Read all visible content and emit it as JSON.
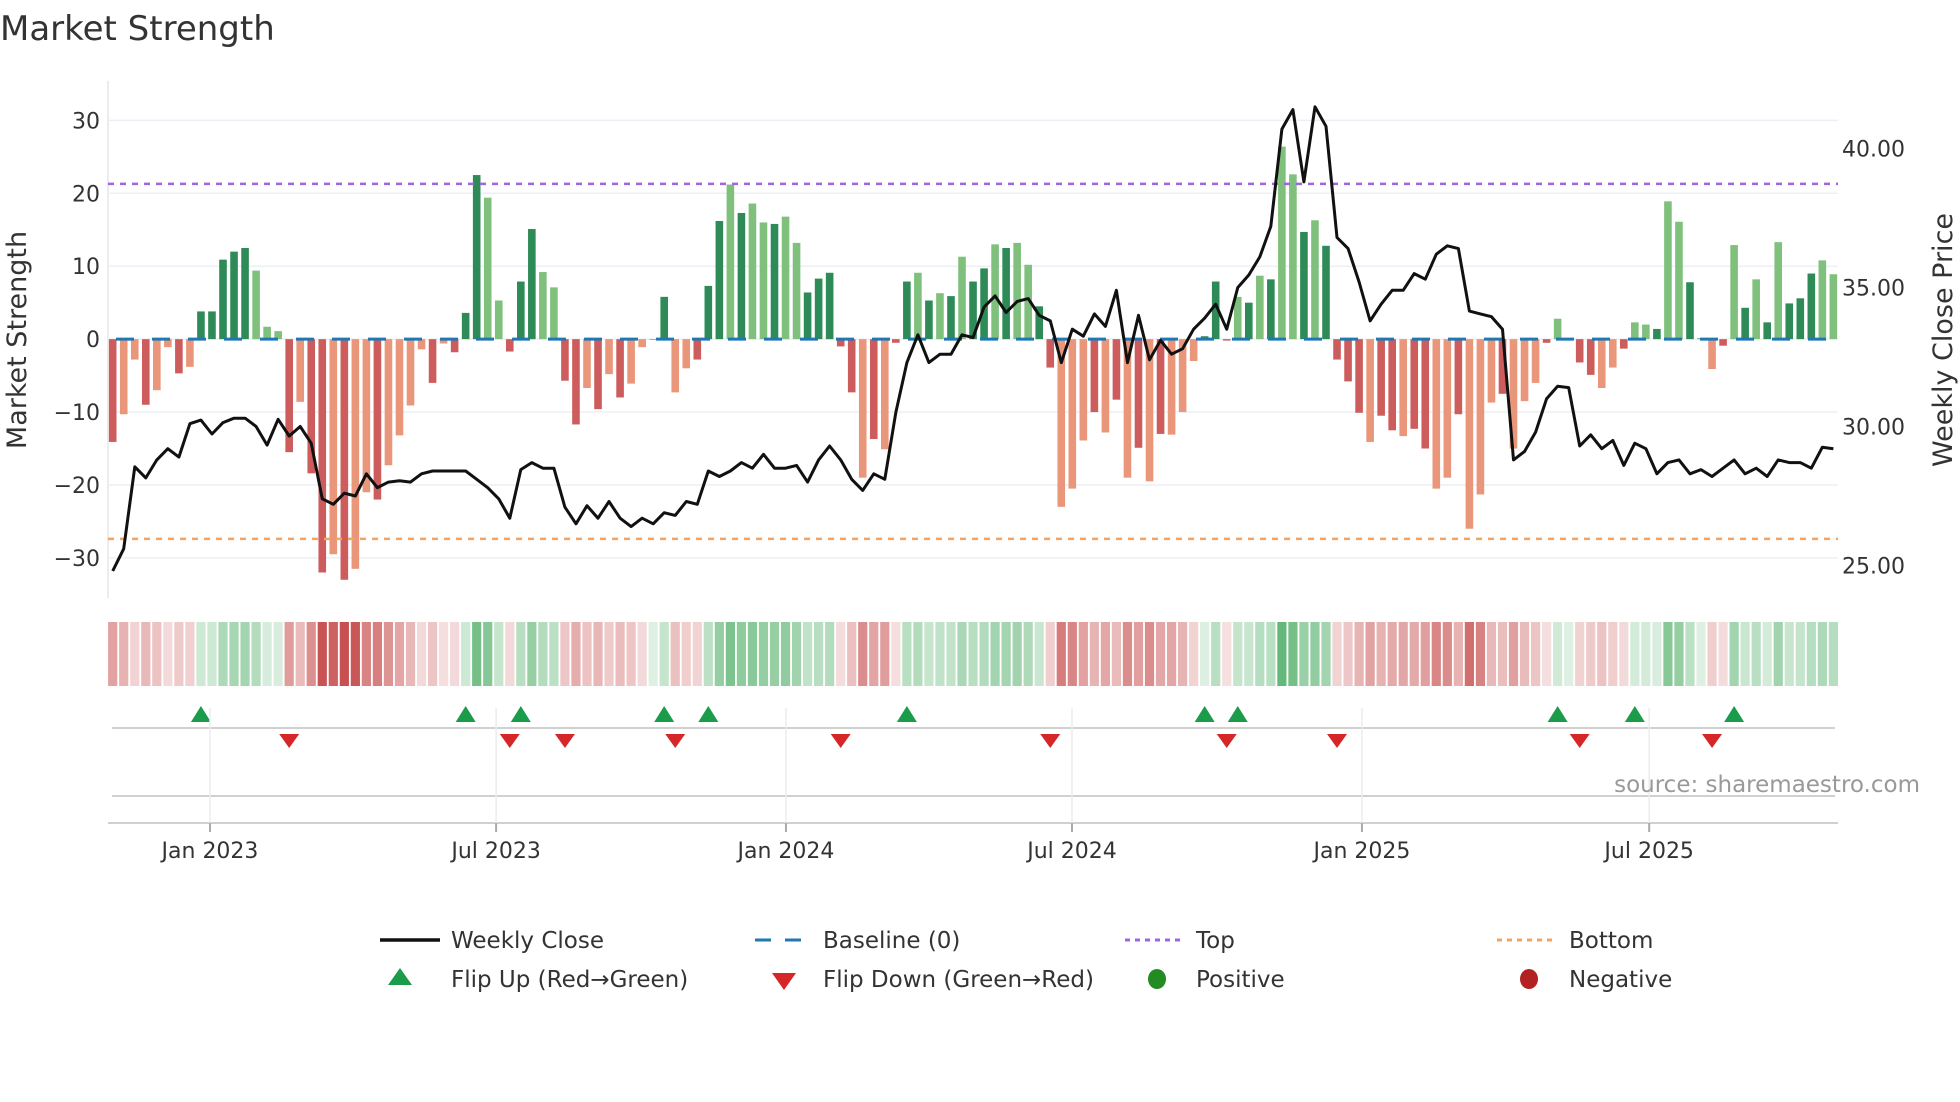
{
  "chart_data": {
    "type": "bar",
    "title": "Market Strength",
    "ylabel": "Market Strength",
    "ylabel_right": "Weekly Close Price",
    "ylim": [
      -35.5,
      35.4
    ],
    "ylim_right": [
      23.83,
      42.43
    ],
    "yticks": [
      30,
      20,
      10,
      0,
      -10,
      -20,
      -30
    ],
    "ytick_labels": [
      "30",
      "20",
      "10",
      "0",
      "−10",
      "−20",
      "−30"
    ],
    "yticks_right": [
      40,
      35,
      30,
      25
    ],
    "ytick_labels_right": [
      "40.00",
      "35.00",
      "30.00",
      "25.00"
    ],
    "x_unit": "week index",
    "xticks": [
      {
        "label": "Jan 2023",
        "week": 8.82
      },
      {
        "label": "Jul 2023",
        "week": 34.76
      },
      {
        "label": "Jan 2024",
        "week": 61.04
      },
      {
        "label": "Jul 2024",
        "week": 86.97
      },
      {
        "label": "Jan 2025",
        "week": 113.26
      },
      {
        "label": "Jul 2025",
        "week": 139.3
      }
    ],
    "top_level": 21.3,
    "bottom_level": -27.4,
    "baseline": 0,
    "strength": [
      -14.1,
      -10.3,
      -2.8,
      -9,
      -7,
      -1.1,
      -4.7,
      -3.8,
      3.8,
      3.8,
      10.9,
      12,
      12.5,
      9.4,
      1.7,
      1.1,
      -15.5,
      -8.6,
      -18.4,
      -32,
      -29.5,
      -33,
      -31.5,
      -21,
      -22,
      -17.3,
      -13.2,
      -9.1,
      -1.4,
      -6,
      -0.6,
      -1.8,
      3.6,
      22.5,
      19.4,
      5.3,
      -1.7,
      7.9,
      15.1,
      9.2,
      7.1,
      -5.7,
      -11.7,
      -6.7,
      -9.6,
      -4.8,
      -8,
      -6.1,
      -1.1,
      0,
      5.8,
      -7.3,
      -4,
      -2.8,
      7.3,
      16.2,
      21.2,
      17.3,
      18.6,
      16,
      15.8,
      16.8,
      13.2,
      6.4,
      8.3,
      9.1,
      -1,
      -7.3,
      -19,
      -13.7,
      -15.1,
      -0.5,
      7.9,
      9.1,
      5.3,
      6.3,
      5.9,
      11.3,
      7.9,
      9.7,
      13,
      12.5,
      13.2,
      10.2,
      4.5,
      -3.9,
      -23,
      -20.5,
      -13.9,
      -10,
      -12.8,
      -8.3,
      -19,
      -14.9,
      -19.5,
      -13,
      -13.1,
      -10,
      -3,
      0.4,
      7.9,
      -0.2,
      5.8,
      5,
      8.7,
      8.2,
      26.4,
      22.6,
      14.7,
      16.3,
      12.8,
      -2.8,
      -5.8,
      -10.1,
      -14.1,
      -10.5,
      -12.5,
      -13.3,
      -12.3,
      -15,
      -20.5,
      -19,
      -10.3,
      -26,
      -21.3,
      -8.7,
      -7.5,
      -15,
      -8.5,
      -6,
      -0.5,
      2.8,
      0,
      -3.2,
      -4.9,
      -6.7,
      -3.9,
      -1.3,
      2.3,
      2,
      1.4,
      18.9,
      16.1,
      7.8,
      0.1,
      -4.1,
      -0.9,
      12.9,
      4.3,
      8.2,
      2.3,
      13.3,
      4.9,
      5.6,
      9,
      10.8,
      8.9
    ],
    "close": [
      24.8,
      25.6,
      28.55,
      28.15,
      28.8,
      29.2,
      28.9,
      30.1,
      30.23,
      29.73,
      30.14,
      30.3,
      30.3,
      30.0,
      29.33,
      30.26,
      29.66,
      30.0,
      29.4,
      27.4,
      27.2,
      27.6,
      27.5,
      28.3,
      27.8,
      28.0,
      28.05,
      28.0,
      28.3,
      28.4,
      28.4,
      28.4,
      28.4,
      28.1,
      27.8,
      27.4,
      26.7,
      28.45,
      28.7,
      28.5,
      28.5,
      27.1,
      26.5,
      27.15,
      26.7,
      27.3,
      26.7,
      26.4,
      26.7,
      26.5,
      26.9,
      26.8,
      27.3,
      27.2,
      28.4,
      28.2,
      28.4,
      28.7,
      28.5,
      29.0,
      28.5,
      28.5,
      28.6,
      28.0,
      28.8,
      29.3,
      28.8,
      28.1,
      27.7,
      28.3,
      28.1,
      30.5,
      32.3,
      33.3,
      32.3,
      32.6,
      32.6,
      33.3,
      33.2,
      34.3,
      34.7,
      34.1,
      34.5,
      34.6,
      34.0,
      33.8,
      32.3,
      33.5,
      33.25,
      34.05,
      33.6,
      34.9,
      32.3,
      34.0,
      32.4,
      33.1,
      32.6,
      32.8,
      33.5,
      33.9,
      34.4,
      33.5,
      35.0,
      35.45,
      36.1,
      37.2,
      40.7,
      41.4,
      38.8,
      41.5,
      40.8,
      36.8,
      36.4,
      35.2,
      33.8,
      34.4,
      34.9,
      34.9,
      35.5,
      35.3,
      36.2,
      36.5,
      36.4,
      34.15,
      34.05,
      33.95,
      33.5,
      28.8,
      29.1,
      29.8,
      31.0,
      31.45,
      31.4,
      29.3,
      29.7,
      29.2,
      29.5,
      28.6,
      29.4,
      29.2,
      28.3,
      28.7,
      28.8,
      28.3,
      28.45,
      28.2,
      28.5,
      28.8,
      28.3,
      28.5,
      28.2,
      28.8,
      28.7,
      28.7,
      28.5,
      29.25,
      29.2
    ],
    "flips_up": [
      8,
      32,
      37,
      50,
      54,
      72,
      99,
      102,
      131,
      138,
      147
    ],
    "flips_down": [
      16,
      36,
      41,
      51,
      66,
      85,
      101,
      111,
      133,
      145
    ],
    "legend": {
      "weekly_close": "Weekly Close",
      "baseline": "Baseline (0)",
      "top": "Top",
      "bottom": "Bottom",
      "flip_up": "Flip Up (Red→Green)",
      "flip_down": "Flip Down (Green→Red)",
      "positive": "Positive",
      "negative": "Negative"
    },
    "legend_placement": "bottom",
    "grid": true
  },
  "shades": "dlldlldldddddllldlddldlldlllldldddlldddllddldldllddlldddldlldlldddddldlddldldlddldllddllldldldldllldddldldlldlddddlddlddlldllldllldldddlldlldllddldldldldddl",
  "source": "source: sharemaestro.com",
  "colors": {
    "pos_dark": "#2e8b57",
    "pos_light": "#80c07d",
    "neg_dark": "#cd5c5c",
    "neg_light": "#e9967a",
    "close": "#111111",
    "baseline": "#1f77b4",
    "top": "#a066e0",
    "bottom": "#f4a460",
    "flip_up": "#1a9c4a",
    "flip_down": "#d62728",
    "positive": "#228b22",
    "negative": "#b22222"
  }
}
